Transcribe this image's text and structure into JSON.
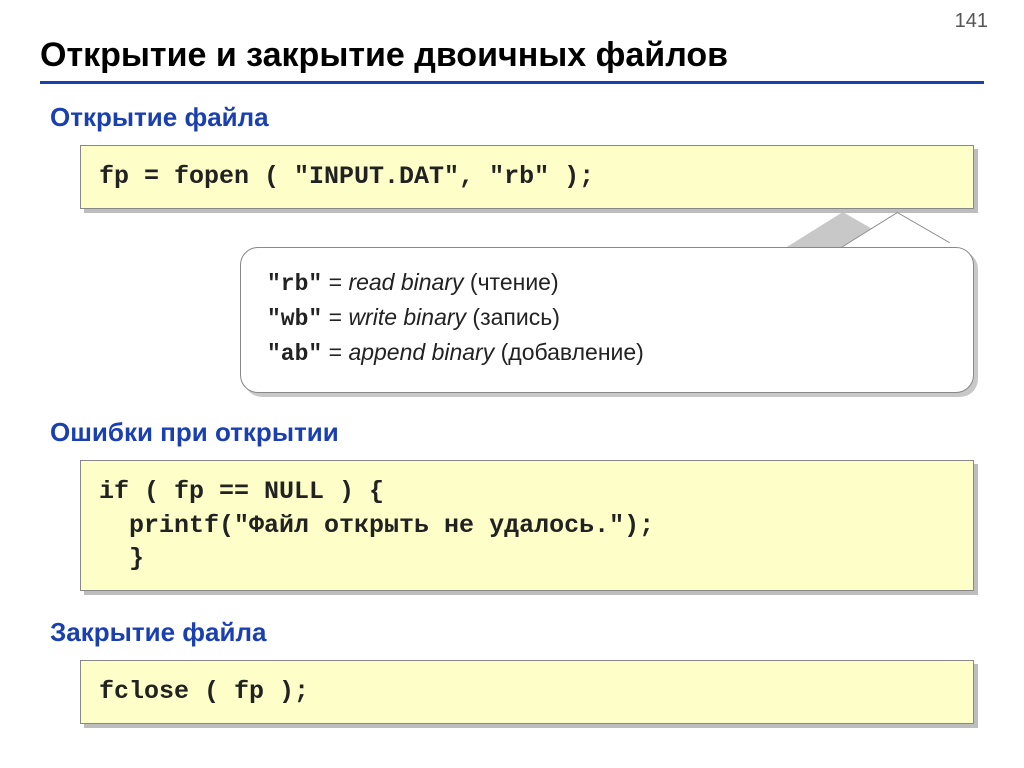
{
  "page_number": "141",
  "title": "Открытие и закрытие двоичных файлов",
  "sections": {
    "open": {
      "label": "Открытие файла",
      "code": "fp = fopen ( \"INPUT.DAT\", \"rb\" );"
    },
    "callout": {
      "line1_mode": "\"rb\"",
      "line1_eq": " = ",
      "line1_desc": "read binary",
      "line1_ru": " (чтение)",
      "line2_mode": "\"wb\"",
      "line2_eq": " = ",
      "line2_desc": "write binary",
      "line2_ru": " (запись)",
      "line3_mode": "\"ab\"",
      "line3_eq": " = ",
      "line3_desc": "append binary",
      "line3_ru": " (добавление)"
    },
    "errors": {
      "label": "Ошибки при открытии",
      "code": "if ( fp == NULL ) {\n  printf(\"Файл открыть не удалось.\");\n  }"
    },
    "close": {
      "label": "Закрытие файла",
      "code": "fclose ( fp );"
    }
  }
}
